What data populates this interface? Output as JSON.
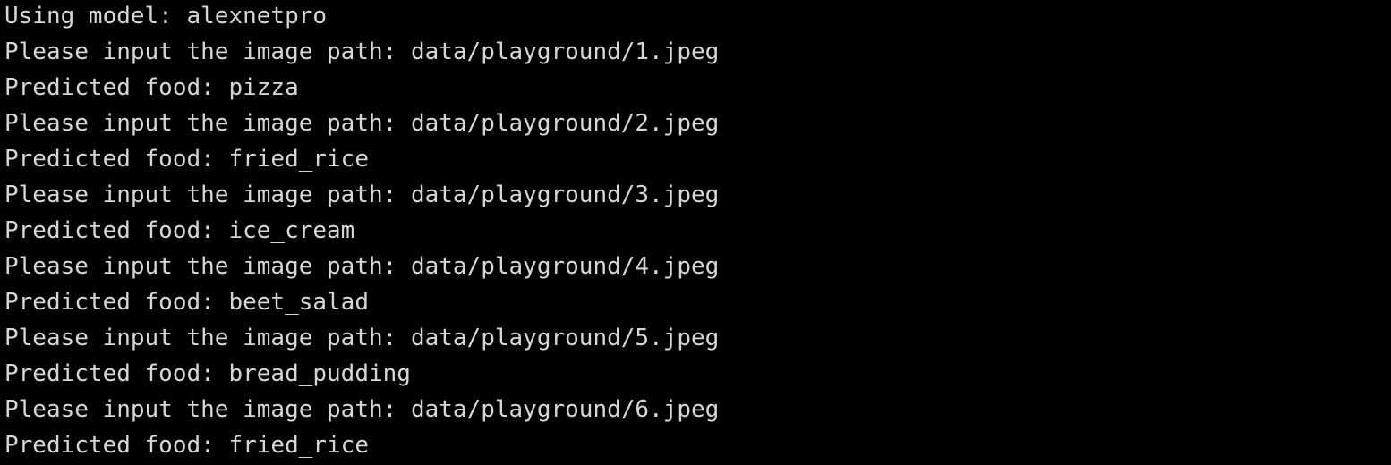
{
  "terminal": {
    "lines": [
      "Using model: alexnetpro",
      "Please input the image path: data/playground/1.jpeg",
      "Predicted food: pizza",
      "Please input the image path: data/playground/2.jpeg",
      "Predicted food: fried_rice",
      "Please input the image path: data/playground/3.jpeg",
      "Predicted food: ice_cream",
      "Please input the image path: data/playground/4.jpeg",
      "Predicted food: beet_salad",
      "Please input the image path: data/playground/5.jpeg",
      "Predicted food: bread_pudding",
      "Please input the image path: data/playground/6.jpeg",
      "Predicted food: fried_rice"
    ]
  },
  "colors": {
    "background": "#000000",
    "text": "#d6d6d6"
  }
}
